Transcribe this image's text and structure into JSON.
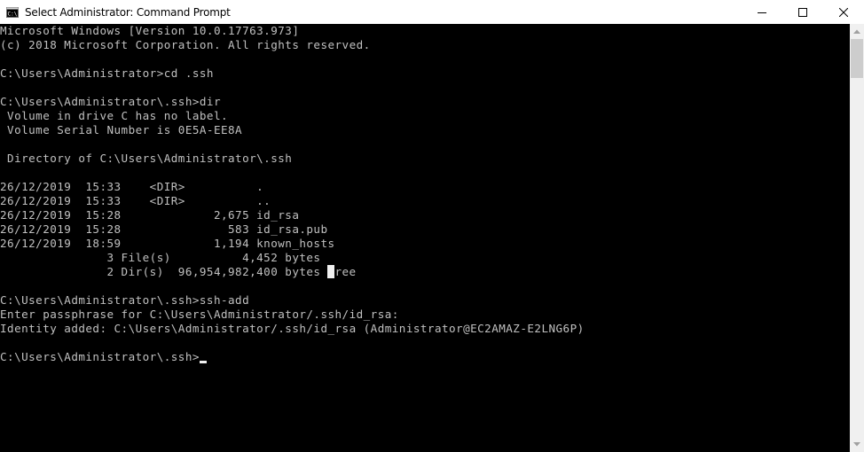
{
  "window": {
    "title": "Select Administrator: Command Prompt",
    "app_icon": "cmd-icon",
    "controls": [
      {
        "name": "minimize-button",
        "icon": "minimize-icon"
      },
      {
        "name": "maximize-button",
        "icon": "maximize-icon"
      },
      {
        "name": "close-button",
        "icon": "close-icon"
      }
    ]
  },
  "console": {
    "lines": [
      "Microsoft Windows [Version 10.0.17763.973]",
      "(c) 2018 Microsoft Corporation. All rights reserved.",
      "",
      "C:\\Users\\Administrator>cd .ssh",
      "",
      "C:\\Users\\Administrator\\.ssh>dir",
      " Volume in drive C has no label.",
      " Volume Serial Number is 0E5A-EE8A",
      "",
      " Directory of C:\\Users\\Administrator\\.ssh",
      "",
      "26/12/2019  15:33    <DIR>          .",
      "26/12/2019  15:33    <DIR>          ..",
      "26/12/2019  15:28             2,675 id_rsa",
      "26/12/2019  15:28               583 id_rsa.pub",
      "26/12/2019  18:59             1,194 known_hosts",
      "               3 File(s)          4,452 bytes",
      "               2 Dir(s)  96,954,982,400 bytes free",
      "",
      "C:\\Users\\Administrator\\.ssh>ssh-add",
      "Enter passphrase for C:\\Users\\Administrator/.ssh/id_rsa:",
      "Identity added: C:\\Users\\Administrator/.ssh/id_rsa (Administrator@EC2AMAZ-E2LNG6P)",
      "",
      "C:\\Users\\Administrator\\.ssh>"
    ],
    "selection_line": 17,
    "selection_col": 46,
    "cursor_line": 23
  },
  "colors": {
    "background": "#000000",
    "text": "#c0c0c0",
    "titlebar": "#ffffff",
    "scrollbar_track": "#f0f0f0",
    "scrollbar_thumb": "#cdcdcd"
  }
}
